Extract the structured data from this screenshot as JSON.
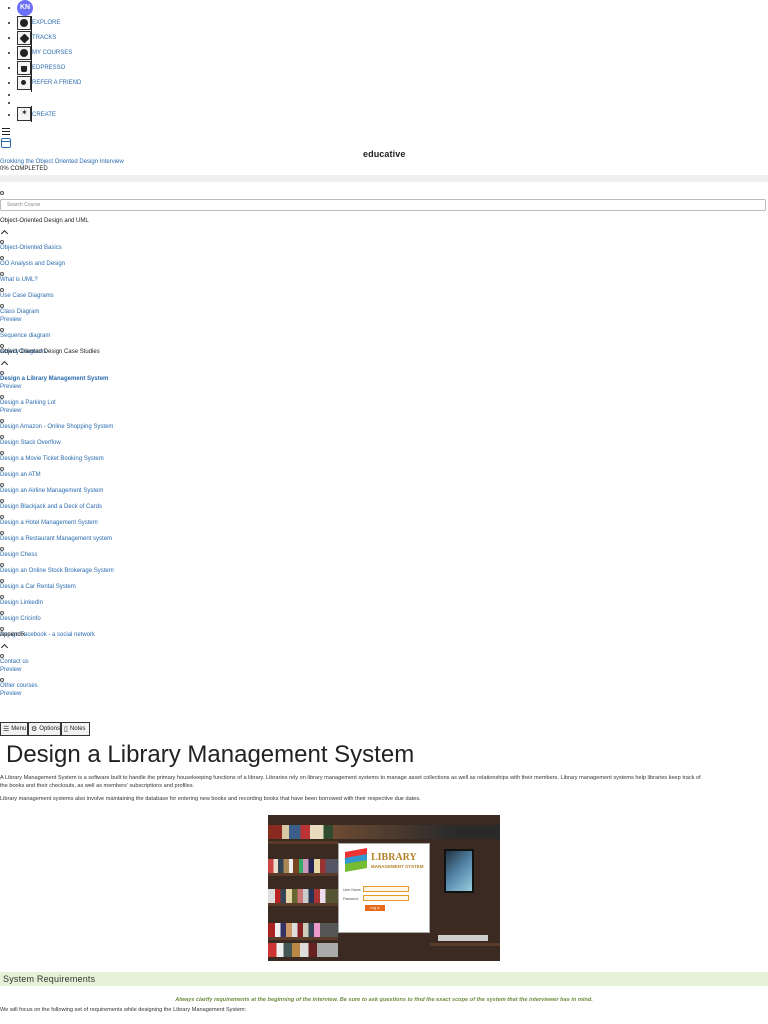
{
  "nav": {
    "avatar": "KN",
    "items": [
      {
        "label": "EXPLORE",
        "icon": "compass-icon"
      },
      {
        "label": "TRACKS",
        "icon": "tracks-icon"
      },
      {
        "label": "MY COURSES",
        "icon": "my-courses-icon"
      },
      {
        "label": "EDPRESSO",
        "icon": "cup-icon"
      },
      {
        "label": "REFER A FRIEND",
        "icon": "add-user-icon"
      },
      {
        "label": "CREATE",
        "icon": "sparkle-icon"
      }
    ]
  },
  "header": {
    "brand": "educative"
  },
  "course": {
    "title": "Grokking the Object Oriented Design Interview",
    "progress": "0% COMPLETED",
    "progress_value": 0
  },
  "search": {
    "placeholder": "Search Course"
  },
  "sidebar": {
    "sections": [
      {
        "title": "Object-Oriented Design and UML",
        "lessons": [
          {
            "label": "Object-Oriented Basics"
          },
          {
            "label": "OO Analysis and Design"
          },
          {
            "label": "What is UML?"
          },
          {
            "label": "Use Case Diagrams"
          },
          {
            "label": "Class Diagram",
            "preview": "Preview"
          },
          {
            "label": "Sequence diagram"
          },
          {
            "label": "Activity Diagrams"
          }
        ]
      },
      {
        "title": "Object Oriented Design Case Studies",
        "lessons": [
          {
            "label": "Design a Library Management System",
            "preview": "Preview",
            "active": true
          },
          {
            "label": "Design a Parking Lot",
            "preview": "Preview"
          },
          {
            "label": "Design Amazon - Online Shopping System"
          },
          {
            "label": "Design Stack Overflow"
          },
          {
            "label": "Design a Movie Ticket Booking System"
          },
          {
            "label": "Design an ATM"
          },
          {
            "label": "Design an Airline Management System"
          },
          {
            "label": "Design Blackjack and a Deck of Cards"
          },
          {
            "label": "Design a Hotel Management System"
          },
          {
            "label": "Design a Restaurant Management system"
          },
          {
            "label": "Design Chess"
          },
          {
            "label": "Design an Online Stock Brokerage System"
          },
          {
            "label": "Design a Car Rental System"
          },
          {
            "label": "Design LinkedIn"
          },
          {
            "label": "Design Cricinfo"
          },
          {
            "label": "Design Facebook - a social network"
          }
        ]
      },
      {
        "title": "Appendix",
        "lessons": [
          {
            "label": "Contact us",
            "preview": "Preview"
          },
          {
            "label": "Other courses",
            "preview": "Preview"
          }
        ]
      }
    ]
  },
  "toolbar": {
    "menu": "Menu",
    "options": "Options",
    "notes": "Notes"
  },
  "article": {
    "title": "Design a Library Management System",
    "p1_line1": "A Library Management System is a software built to handle the primary housekeeping functions of a library. Libraries rely on library management systems to manage asset collections as well as relationships with their members. Library management systems help libraries keep track of",
    "p1_line2": "the books and their checkouts, as well as members’ subscriptions and profiles.",
    "p2": "Library management systems also involve maintaining the database for entering new books and recording books that have been borrowed with their respective due dates.",
    "image": {
      "logo_line1": "LIBRARY",
      "logo_line2": "MANAGEMENT SYSTEM",
      "user_label": "User Name",
      "pass_label": "Password",
      "login": "Log in"
    },
    "req_heading": "System Requirements",
    "tip": "Always clarify requirements at the beginning of the interview. Be sure to ask questions to find the exact scope of the system that the interviewer has in mind.",
    "req_intro": "We will focus on the following set of requirements while designing the Library Management System:"
  },
  "colors": {
    "accent": "#2b6cb0",
    "avatar": "#6b6ef7",
    "req_bg": "#e6f2d7",
    "tip": "#6e8b3d"
  }
}
